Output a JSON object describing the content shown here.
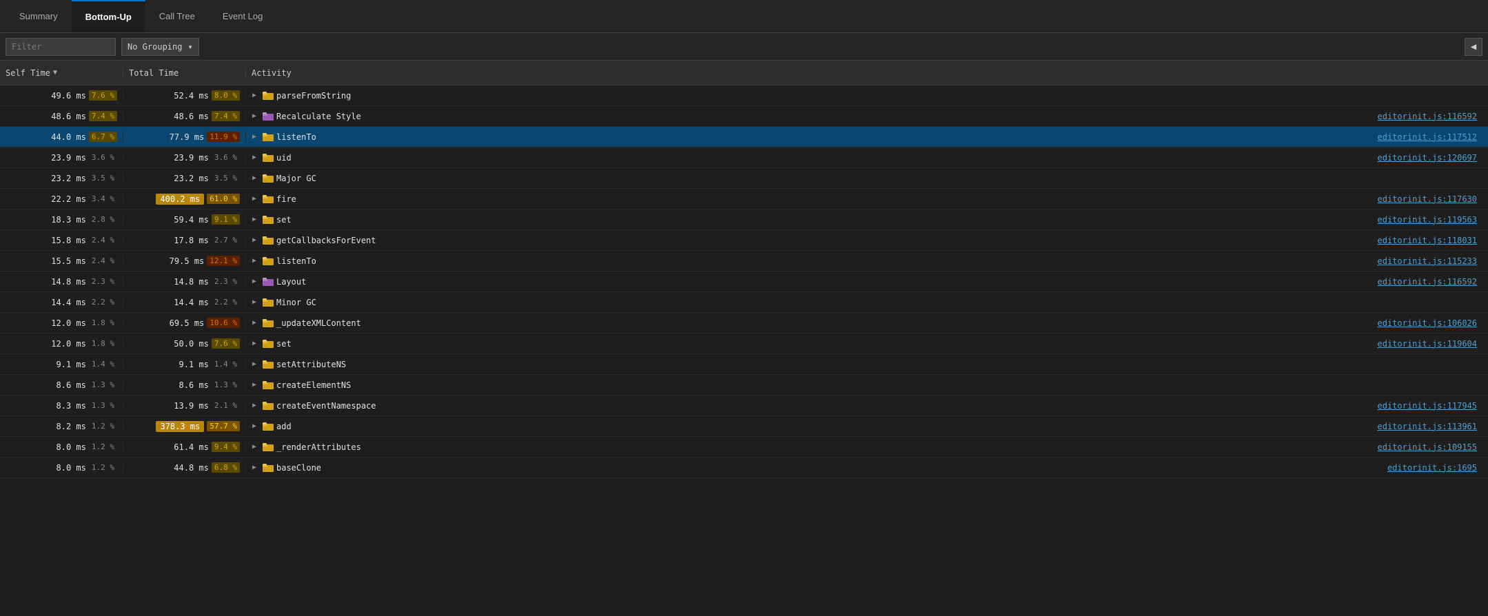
{
  "tabs": [
    {
      "id": "summary",
      "label": "Summary",
      "active": false
    },
    {
      "id": "bottom-up",
      "label": "Bottom-Up",
      "active": true
    },
    {
      "id": "call-tree",
      "label": "Call Tree",
      "active": false
    },
    {
      "id": "event-log",
      "label": "Event Log",
      "active": false
    }
  ],
  "toolbar": {
    "filter_placeholder": "Filter",
    "grouping_label": "No Grouping",
    "collapse_icon": "◀"
  },
  "columns": {
    "self_time": "Self Time",
    "total_time": "Total Time",
    "activity": "Activity"
  },
  "rows": [
    {
      "self_ms": "49.6 ms",
      "self_pct": "7.6 %",
      "total_ms": "52.4 ms",
      "total_pct": "8.0 %",
      "name": "parseFromString",
      "link": "",
      "folder_type": "yellow",
      "selected": false,
      "highlighted": false,
      "special_total": false
    },
    {
      "self_ms": "48.6 ms",
      "self_pct": "7.4 %",
      "total_ms": "48.6 ms",
      "total_pct": "7.4 %",
      "name": "Recalculate Style",
      "link": "editorinit.js:116592",
      "folder_type": "purple",
      "selected": false,
      "highlighted": false,
      "special_total": false
    },
    {
      "self_ms": "44.0 ms",
      "self_pct": "6.7 %",
      "total_ms": "77.9 ms",
      "total_pct": "11.9 %",
      "name": "listenTo",
      "link": "editorinit.js:117512",
      "folder_type": "yellow",
      "selected": true,
      "highlighted": false,
      "special_total": false
    },
    {
      "self_ms": "23.9 ms",
      "self_pct": "3.6 %",
      "total_ms": "23.9 ms",
      "total_pct": "3.6 %",
      "name": "uid",
      "link": "editorinit.js:120697",
      "folder_type": "yellow",
      "selected": false,
      "highlighted": false,
      "special_total": false
    },
    {
      "self_ms": "23.2 ms",
      "self_pct": "3.5 %",
      "total_ms": "23.2 ms",
      "total_pct": "3.5 %",
      "name": "Major GC",
      "link": "",
      "folder_type": "yellow",
      "selected": false,
      "highlighted": false,
      "special_total": false
    },
    {
      "self_ms": "22.2 ms",
      "self_pct": "3.4 %",
      "total_ms": "400.2 ms",
      "total_pct": "61.0 %",
      "name": "fire",
      "link": "editorinit.js:117630",
      "folder_type": "yellow",
      "selected": false,
      "highlighted": false,
      "special_total": true
    },
    {
      "self_ms": "18.3 ms",
      "self_pct": "2.8 %",
      "total_ms": "59.4 ms",
      "total_pct": "9.1 %",
      "name": "set",
      "link": "editorinit.js:119563",
      "folder_type": "yellow",
      "selected": false,
      "highlighted": false,
      "special_total": false
    },
    {
      "self_ms": "15.8 ms",
      "self_pct": "2.4 %",
      "total_ms": "17.8 ms",
      "total_pct": "2.7 %",
      "name": "getCallbacksForEvent",
      "link": "editorinit.js:118031",
      "folder_type": "yellow",
      "selected": false,
      "highlighted": false,
      "special_total": false
    },
    {
      "self_ms": "15.5 ms",
      "self_pct": "2.4 %",
      "total_ms": "79.5 ms",
      "total_pct": "12.1 %",
      "name": "listenTo",
      "link": "editorinit.js:115233",
      "folder_type": "yellow",
      "selected": false,
      "highlighted": false,
      "special_total": false
    },
    {
      "self_ms": "14.8 ms",
      "self_pct": "2.3 %",
      "total_ms": "14.8 ms",
      "total_pct": "2.3 %",
      "name": "Layout",
      "link": "editorinit.js:116592",
      "folder_type": "purple",
      "selected": false,
      "highlighted": false,
      "special_total": false
    },
    {
      "self_ms": "14.4 ms",
      "self_pct": "2.2 %",
      "total_ms": "14.4 ms",
      "total_pct": "2.2 %",
      "name": "Minor GC",
      "link": "",
      "folder_type": "yellow",
      "selected": false,
      "highlighted": false,
      "special_total": false
    },
    {
      "self_ms": "12.0 ms",
      "self_pct": "1.8 %",
      "total_ms": "69.5 ms",
      "total_pct": "10.6 %",
      "name": "_updateXMLContent",
      "link": "editorinit.js:106026",
      "folder_type": "yellow",
      "selected": false,
      "highlighted": false,
      "special_total": false
    },
    {
      "self_ms": "12.0 ms",
      "self_pct": "1.8 %",
      "total_ms": "50.0 ms",
      "total_pct": "7.6 %",
      "name": "set",
      "link": "editorinit.js:119604",
      "folder_type": "yellow",
      "selected": false,
      "highlighted": false,
      "special_total": false
    },
    {
      "self_ms": "9.1 ms",
      "self_pct": "1.4 %",
      "total_ms": "9.1 ms",
      "total_pct": "1.4 %",
      "name": "setAttributeNS",
      "link": "",
      "folder_type": "yellow",
      "selected": false,
      "highlighted": false,
      "special_total": false
    },
    {
      "self_ms": "8.6 ms",
      "self_pct": "1.3 %",
      "total_ms": "8.6 ms",
      "total_pct": "1.3 %",
      "name": "createElementNS",
      "link": "",
      "folder_type": "yellow",
      "selected": false,
      "highlighted": false,
      "special_total": false
    },
    {
      "self_ms": "8.3 ms",
      "self_pct": "1.3 %",
      "total_ms": "13.9 ms",
      "total_pct": "2.1 %",
      "name": "createEventNamespace",
      "link": "editorinit.js:117945",
      "folder_type": "yellow",
      "selected": false,
      "highlighted": false,
      "special_total": false
    },
    {
      "self_ms": "8.2 ms",
      "self_pct": "1.2 %",
      "total_ms": "378.3 ms",
      "total_pct": "57.7 %",
      "name": "add",
      "link": "editorinit.js:113961",
      "folder_type": "yellow",
      "selected": false,
      "highlighted": false,
      "special_total": true
    },
    {
      "self_ms": "8.0 ms",
      "self_pct": "1.2 %",
      "total_ms": "61.4 ms",
      "total_pct": "9.4 %",
      "name": "_renderAttributes",
      "link": "editorinit.js:109155",
      "folder_type": "yellow",
      "selected": false,
      "highlighted": false,
      "special_total": false
    },
    {
      "self_ms": "8.0 ms",
      "self_pct": "1.2 %",
      "total_ms": "44.8 ms",
      "total_pct": "6.8 %",
      "name": "baseClone",
      "link": "editorinit.js:1695",
      "folder_type": "yellow",
      "selected": false,
      "highlighted": false,
      "special_total": false
    }
  ]
}
